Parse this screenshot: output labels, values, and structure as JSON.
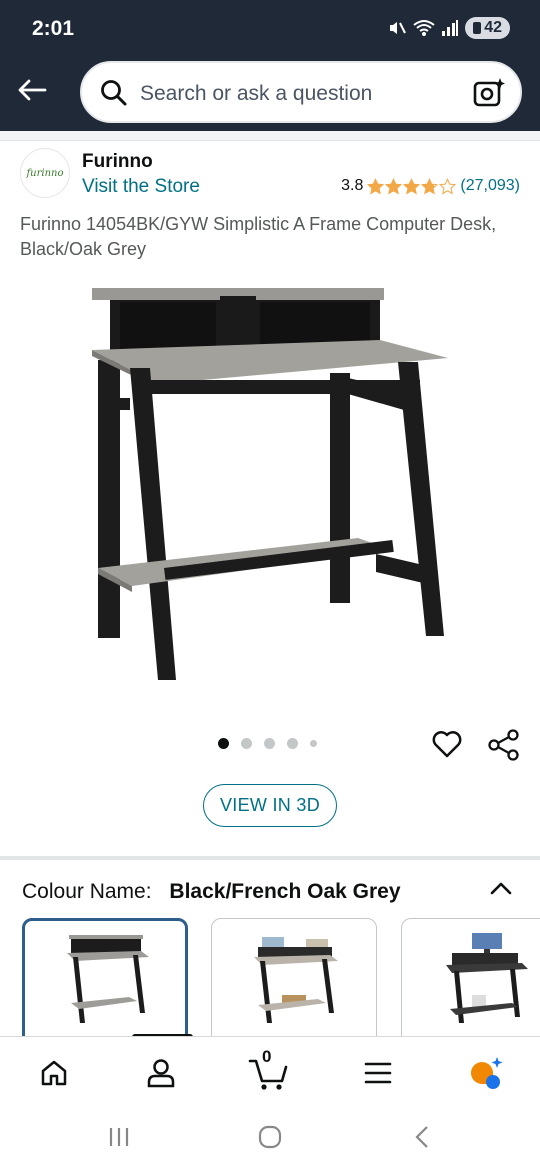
{
  "status_bar": {
    "time": "2:01",
    "battery": "42",
    "icons": [
      "mute-icon",
      "wifi-icon",
      "signal-icon",
      "battery-icon"
    ]
  },
  "search": {
    "placeholder": "Search or ask a question",
    "back_icon": "back-arrow-icon",
    "search_icon": "search-icon",
    "camera_icon": "camera-lens-icon"
  },
  "store": {
    "logo_text": "furinno",
    "brand": "Furinno",
    "visit_link": "Visit the Store",
    "rating_value": "3.8",
    "rating_stars": 3.8,
    "rating_count": "(27,093)"
  },
  "product": {
    "title": "Furinno 14054BK/GYW Simplistic A Frame Computer Desk, Black/Oak Grey",
    "image_count": 5,
    "active_image_index": 0,
    "view_3d_label": "VIEW IN 3D"
  },
  "variation": {
    "label": "Colour Name:",
    "value": "Black/French Oak Grey",
    "selected_index": 0
  },
  "bottom_nav": {
    "cart_count": "0",
    "items": [
      "home-icon",
      "account-icon",
      "cart-icon",
      "menu-icon",
      "rufus-assistant-icon"
    ]
  },
  "colors": {
    "header_bg": "#1f2937",
    "link": "#007185",
    "star": "#f3a847",
    "text": "#0f1111",
    "selected_swatch_border": "#2e5f8a"
  }
}
